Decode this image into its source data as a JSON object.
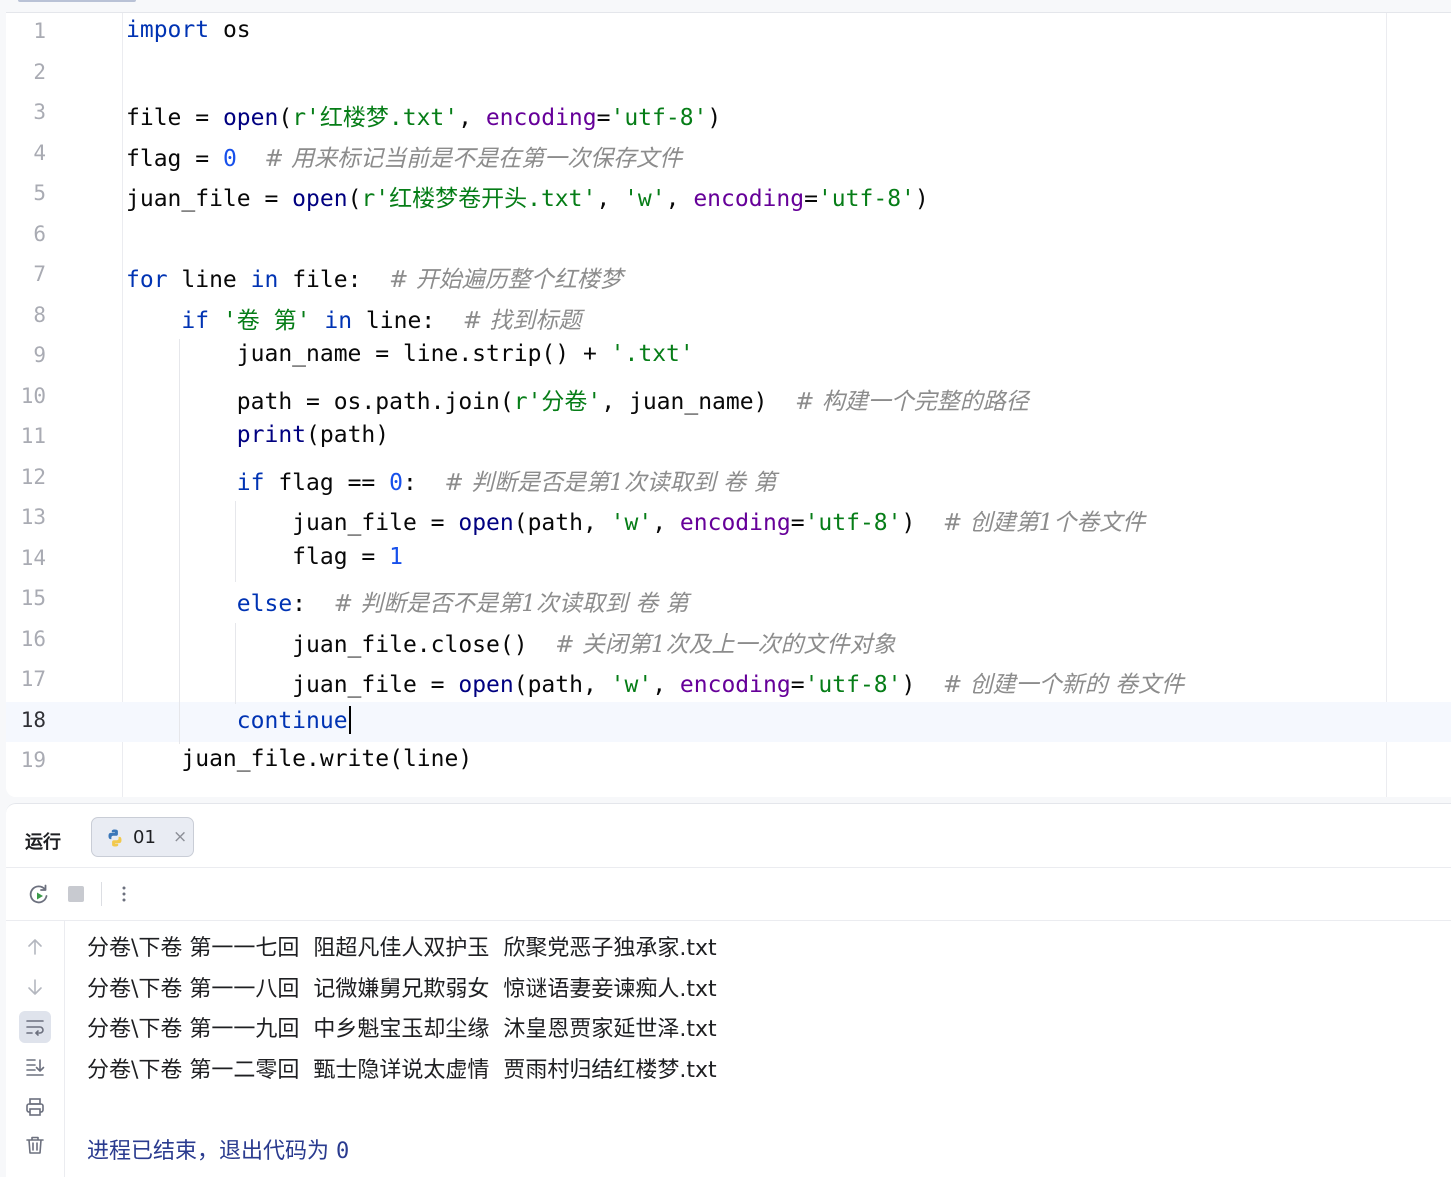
{
  "editor": {
    "lines": [
      {
        "n": "1",
        "tokens": [
          {
            "t": "import",
            "c": "kw"
          },
          {
            "t": " os",
            "c": ""
          }
        ]
      },
      {
        "n": "2",
        "tokens": []
      },
      {
        "n": "3",
        "tokens": [
          {
            "t": "file = ",
            "c": ""
          },
          {
            "t": "open",
            "c": "fn"
          },
          {
            "t": "(",
            "c": ""
          },
          {
            "t": "r'红楼梦.txt'",
            "c": "str"
          },
          {
            "t": ", ",
            "c": ""
          },
          {
            "t": "encoding",
            "c": "kwarg"
          },
          {
            "t": "=",
            "c": ""
          },
          {
            "t": "'utf-8'",
            "c": "str"
          },
          {
            "t": ")",
            "c": ""
          }
        ]
      },
      {
        "n": "4",
        "tokens": [
          {
            "t": "flag = ",
            "c": ""
          },
          {
            "t": "0",
            "c": "num"
          },
          {
            "t": "  ",
            "c": ""
          },
          {
            "t": "# 用来标记当前是不是在第一次保存文件",
            "c": "cmt"
          }
        ]
      },
      {
        "n": "5",
        "tokens": [
          {
            "t": "juan_file = ",
            "c": ""
          },
          {
            "t": "open",
            "c": "fn"
          },
          {
            "t": "(",
            "c": ""
          },
          {
            "t": "r'红楼梦卷开头.txt'",
            "c": "str"
          },
          {
            "t": ", ",
            "c": ""
          },
          {
            "t": "'w'",
            "c": "str"
          },
          {
            "t": ", ",
            "c": ""
          },
          {
            "t": "encoding",
            "c": "kwarg"
          },
          {
            "t": "=",
            "c": ""
          },
          {
            "t": "'utf-8'",
            "c": "str"
          },
          {
            "t": ")",
            "c": ""
          }
        ]
      },
      {
        "n": "6",
        "tokens": []
      },
      {
        "n": "7",
        "tokens": [
          {
            "t": "for",
            "c": "kw"
          },
          {
            "t": " line ",
            "c": ""
          },
          {
            "t": "in",
            "c": "kw"
          },
          {
            "t": " file:  ",
            "c": ""
          },
          {
            "t": "# 开始遍历整个红楼梦",
            "c": "cmt"
          }
        ]
      },
      {
        "n": "8",
        "tokens": [
          {
            "t": "    ",
            "c": ""
          },
          {
            "t": "if",
            "c": "kw"
          },
          {
            "t": " ",
            "c": ""
          },
          {
            "t": "'卷 第'",
            "c": "str"
          },
          {
            "t": " ",
            "c": ""
          },
          {
            "t": "in",
            "c": "kw"
          },
          {
            "t": " line:  ",
            "c": ""
          },
          {
            "t": "# 找到标题",
            "c": "cmt"
          }
        ]
      },
      {
        "n": "9",
        "tokens": [
          {
            "t": "        juan_name = line.strip() + ",
            "c": ""
          },
          {
            "t": "'.txt'",
            "c": "str"
          }
        ]
      },
      {
        "n": "10",
        "tokens": [
          {
            "t": "        path = os.path.join(",
            "c": ""
          },
          {
            "t": "r'分卷'",
            "c": "str"
          },
          {
            "t": ", juan_name)  ",
            "c": ""
          },
          {
            "t": "# 构建一个完整的路径",
            "c": "cmt"
          }
        ]
      },
      {
        "n": "11",
        "tokens": [
          {
            "t": "        ",
            "c": ""
          },
          {
            "t": "print",
            "c": "fn"
          },
          {
            "t": "(path)",
            "c": ""
          }
        ]
      },
      {
        "n": "12",
        "tokens": [
          {
            "t": "        ",
            "c": ""
          },
          {
            "t": "if",
            "c": "kw"
          },
          {
            "t": " flag == ",
            "c": ""
          },
          {
            "t": "0",
            "c": "num"
          },
          {
            "t": ":  ",
            "c": ""
          },
          {
            "t": "# 判断是否是第1次读取到 卷 第",
            "c": "cmt"
          }
        ]
      },
      {
        "n": "13",
        "tokens": [
          {
            "t": "            juan_file = ",
            "c": ""
          },
          {
            "t": "open",
            "c": "fn"
          },
          {
            "t": "(path, ",
            "c": ""
          },
          {
            "t": "'w'",
            "c": "str"
          },
          {
            "t": ", ",
            "c": ""
          },
          {
            "t": "encoding",
            "c": "kwarg"
          },
          {
            "t": "=",
            "c": ""
          },
          {
            "t": "'utf-8'",
            "c": "str"
          },
          {
            "t": ")  ",
            "c": ""
          },
          {
            "t": "# 创建第1个卷文件",
            "c": "cmt"
          }
        ]
      },
      {
        "n": "14",
        "tokens": [
          {
            "t": "            flag = ",
            "c": ""
          },
          {
            "t": "1",
            "c": "num"
          }
        ]
      },
      {
        "n": "15",
        "tokens": [
          {
            "t": "        ",
            "c": ""
          },
          {
            "t": "else",
            "c": "kw"
          },
          {
            "t": ":  ",
            "c": ""
          },
          {
            "t": "# 判断是否不是第1次读取到 卷 第",
            "c": "cmt"
          }
        ]
      },
      {
        "n": "16",
        "tokens": [
          {
            "t": "            juan_file.close()  ",
            "c": ""
          },
          {
            "t": "# 关闭第1次及上一次的文件对象",
            "c": "cmt"
          }
        ]
      },
      {
        "n": "17",
        "tokens": [
          {
            "t": "            juan_file = ",
            "c": ""
          },
          {
            "t": "open",
            "c": "fn"
          },
          {
            "t": "(path, ",
            "c": ""
          },
          {
            "t": "'w'",
            "c": "str"
          },
          {
            "t": ", ",
            "c": ""
          },
          {
            "t": "encoding",
            "c": "kwarg"
          },
          {
            "t": "=",
            "c": ""
          },
          {
            "t": "'utf-8'",
            "c": "str"
          },
          {
            "t": ")  ",
            "c": ""
          },
          {
            "t": "# 创建一个新的 卷文件",
            "c": "cmt"
          }
        ]
      },
      {
        "n": "18",
        "tokens": [
          {
            "t": "        ",
            "c": ""
          },
          {
            "t": "continue",
            "c": "kw"
          }
        ],
        "current": true
      },
      {
        "n": "19",
        "tokens": [
          {
            "t": "    juan_file.write(line)",
            "c": ""
          }
        ]
      }
    ]
  },
  "run": {
    "title": "运行",
    "tab_label": "01",
    "tab_close": "×",
    "output_lines": [
      "分卷\\下卷 第一一七回  阻超凡佳人双护玉  欣聚党恶子独承家.txt",
      "分卷\\下卷 第一一八回  记微嫌舅兄欺弱女  惊谜语妻妾谏痴人.txt",
      "分卷\\下卷 第一一九回  中乡魁宝玉却尘缘  沐皇恩贾家延世泽.txt",
      "分卷\\下卷 第一二零回  甄士隐详说太虚情  贾雨村归结红楼梦.txt"
    ],
    "exit_text": "进程已结束，退出代码为 ",
    "exit_code": "0"
  },
  "icons": {
    "rerun": "rerun-icon",
    "stop": "stop-icon",
    "more": "more-vertical-icon",
    "up": "arrow-up-icon",
    "down": "arrow-down-icon",
    "wrap": "soft-wrap-icon",
    "scroll_end": "scroll-to-end-icon",
    "print": "print-icon",
    "delete": "trash-icon"
  },
  "colors": {
    "keyword": "#0033b3",
    "builtin": "#000080",
    "string": "#067d17",
    "kwarg": "#660099",
    "number": "#1750eb",
    "comment": "#8c8c8c",
    "exit_text": "#2a3b8f"
  }
}
